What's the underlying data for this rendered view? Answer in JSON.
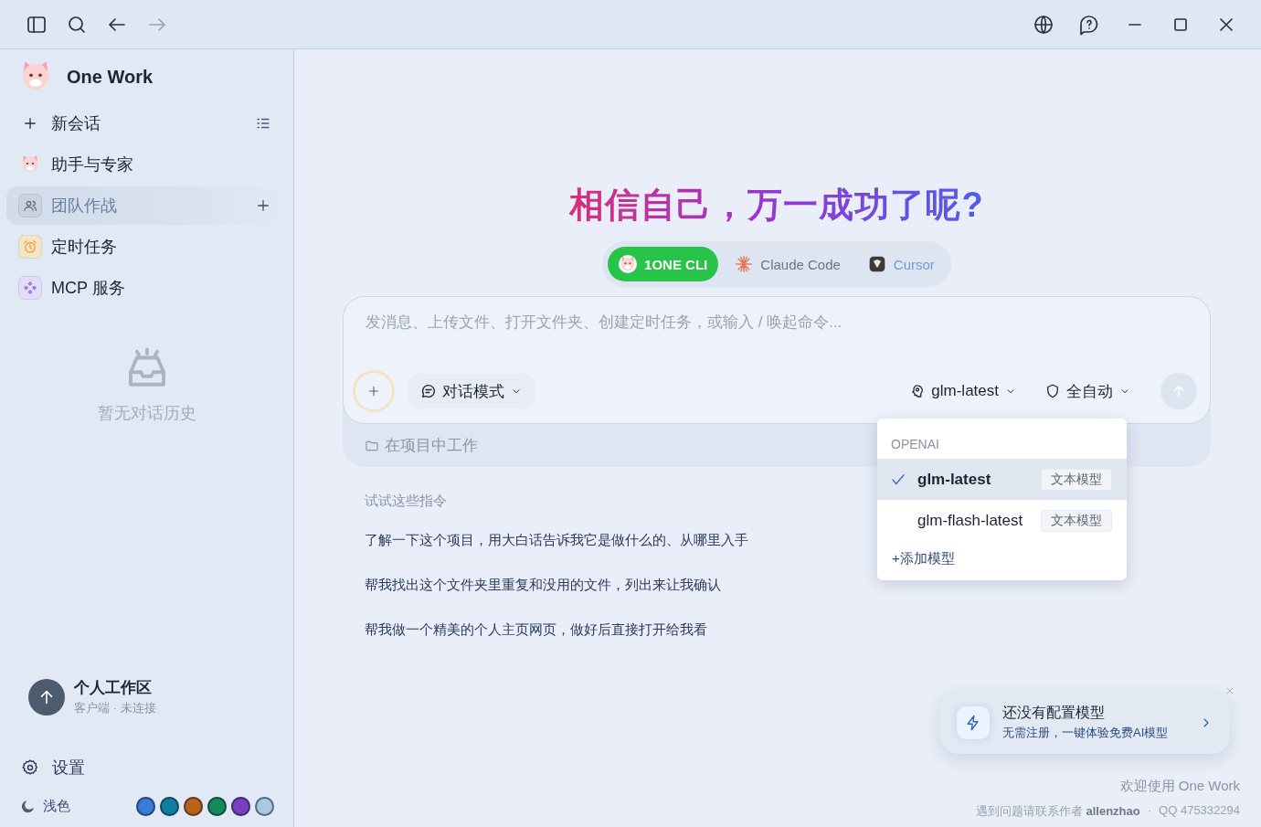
{
  "sidebar": {
    "brand": "One Work",
    "nav": [
      {
        "label": "新会话",
        "kind": "new",
        "selected": false
      },
      {
        "label": "助手与专家",
        "kind": "cat",
        "selected": false
      },
      {
        "label": "团队作战",
        "kind": "team",
        "selected": true
      },
      {
        "label": "定时任务",
        "kind": "clock",
        "selected": false
      },
      {
        "label": "MCP 服务",
        "kind": "mcp",
        "selected": false
      }
    ],
    "empty_history": "暂无对话历史",
    "workspace": {
      "title": "个人工作区",
      "subtitle": "客户端 · 未连接"
    },
    "settings": "设置",
    "theme": {
      "label": "浅色",
      "swatches": [
        {
          "color": "#3a7bd5"
        },
        {
          "color": "#0e7fa0"
        },
        {
          "color": "#b8621c"
        },
        {
          "color": "#178a5a"
        },
        {
          "color": "#7a3fc0"
        },
        {
          "color": "#a8c8e4"
        }
      ]
    }
  },
  "main": {
    "headline": "相信自己，万一成功了呢?",
    "agents": [
      {
        "label": "1ONE CLI",
        "kind": "cat",
        "selected": true,
        "disabled": false
      },
      {
        "label": "Claude Code",
        "kind": "burst",
        "selected": false,
        "disabled": false
      },
      {
        "label": "Cursor",
        "kind": "cube",
        "selected": false,
        "disabled": true
      }
    ],
    "composer": {
      "placeholder": "发消息、上传文件、打开文件夹、创建定时任务，或输入 / 唤起命令...",
      "mode": "对话模式",
      "model": "glm-latest",
      "permission": "全自动",
      "project": "在项目中工作"
    },
    "suggestions": {
      "title": "试试这些指令",
      "items": [
        "了解一下这个项目，用大白话告诉我它是做什么的、从哪里入手",
        "帮我找出这个文件夹里重复和没用的文件，列出来让我确认",
        "帮我做一个精美的个人主页网页，做好后直接打开给我看"
      ]
    },
    "footer": {
      "welcome": "欢迎使用 One Work",
      "contact": "遇到问题请联系作者 **allenzhao**",
      "separator": "·",
      "qq": "QQ 475332294"
    }
  },
  "model_menu": {
    "group": "OPENAI",
    "items": [
      {
        "name": "glm-latest",
        "tag": "文本模型",
        "selected": true
      },
      {
        "name": "glm-flash-latest",
        "tag": "文本模型",
        "selected": false
      }
    ],
    "add": "+添加模型"
  },
  "toast": {
    "title": "还没有配置模型",
    "subtitle": "无需注册，一键体验免费AI模型"
  }
}
